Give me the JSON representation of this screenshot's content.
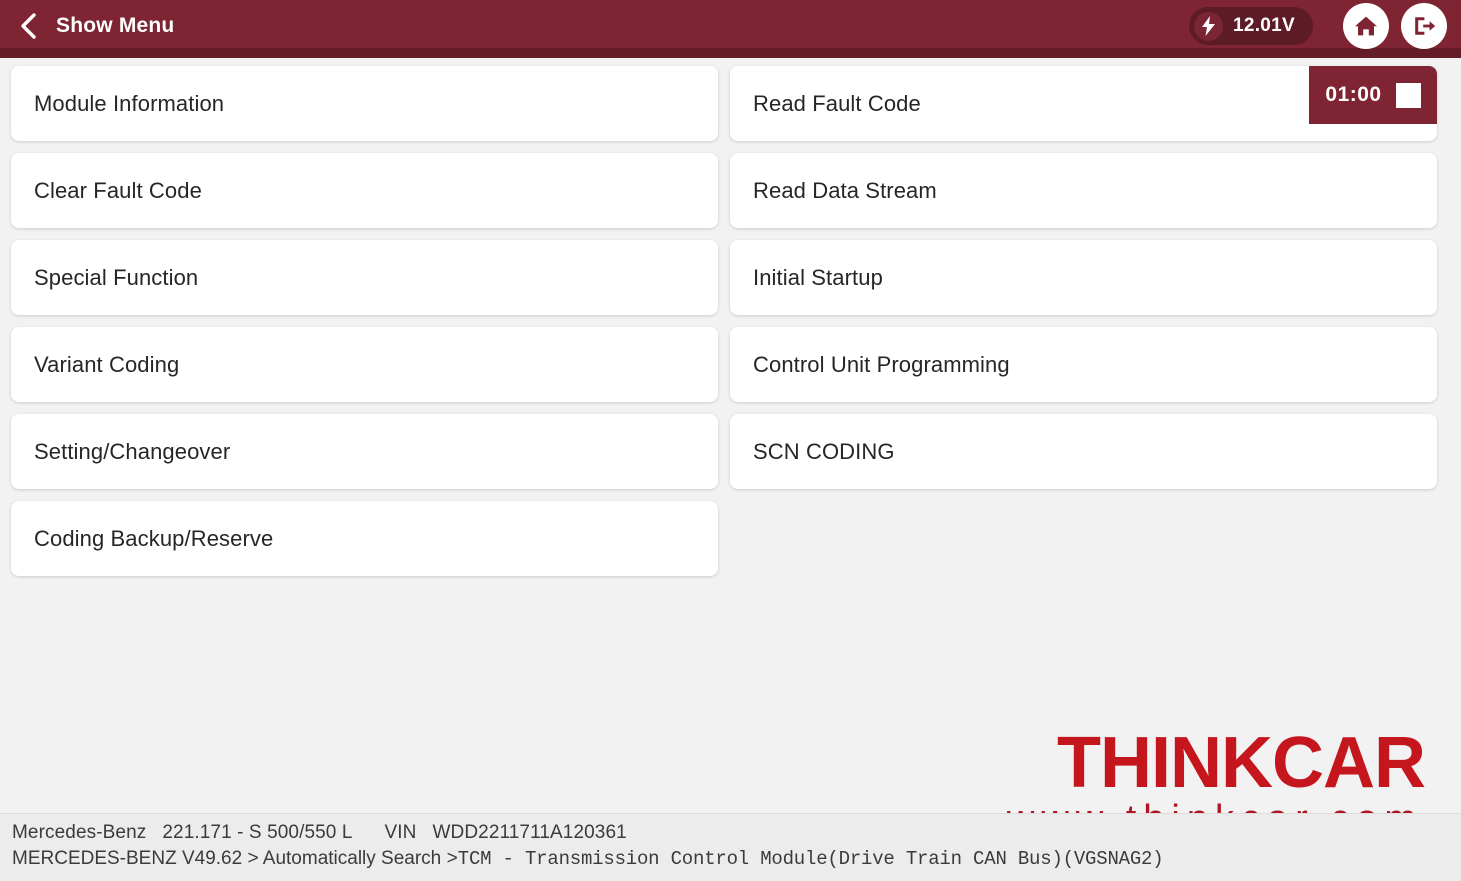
{
  "header": {
    "back_icon": "chevron-left-icon",
    "title": "Show Menu",
    "voltage": "12.01V",
    "bolt_icon": "lightning-bolt-icon",
    "home_icon": "home-icon",
    "exit_icon": "exit-icon",
    "background_color": "#7e2433"
  },
  "timer": {
    "value": "01:00",
    "stop_icon": "stop-square-icon"
  },
  "menu": {
    "left_column": [
      {
        "label": "Module Information"
      },
      {
        "label": "Clear Fault Code"
      },
      {
        "label": "Special Function"
      },
      {
        "label": "Variant Coding"
      },
      {
        "label": "Setting/Changeover"
      },
      {
        "label": "Coding Backup/Reserve"
      }
    ],
    "right_column": [
      {
        "label": "Read Fault Code"
      },
      {
        "label": "Read Data Stream"
      },
      {
        "label": "Initial Startup"
      },
      {
        "label": "Control Unit Programming"
      },
      {
        "label": "SCN CODING"
      }
    ]
  },
  "watermark": {
    "brand": "THINKCAR",
    "url": "www.thinkcar.com",
    "brand_color": "#c4161c"
  },
  "footer": {
    "vehicle_make": "Mercedes-Benz",
    "vehicle_model": "221.171 - S 500/550 L",
    "vin_label": "VIN",
    "vin_value": "WDD2211711A120361",
    "path_prefix": "MERCEDES-BENZ V49.62 > Automatically Search ",
    "path_module": ">TCM - Transmission Control Module(Drive Train CAN Bus)(VGSNAG2)"
  }
}
